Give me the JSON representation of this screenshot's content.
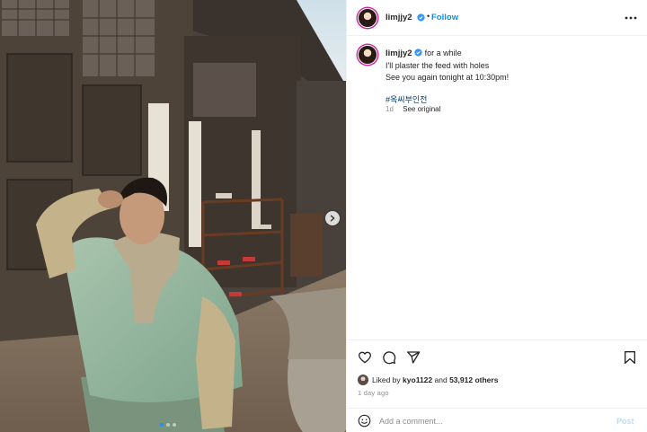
{
  "post": {
    "username": "limjjy2",
    "follow_label": "Follow",
    "separator": "•",
    "caption": {
      "username": "limjjy2",
      "lines": [
        "for a while",
        "I'll plaster the feed with holes",
        "See you again tonight at 10:30pm!"
      ],
      "hashtag": "#옥씨부인전"
    },
    "age_short": "1d",
    "see_original": "See original",
    "likes": {
      "prefix": "Liked by",
      "user": "kyo1122",
      "conjunction": "and",
      "others": "53,912 others"
    },
    "posted_ago": "1 day ago",
    "comment": {
      "placeholder": "Add a comment...",
      "post_label": "Post"
    },
    "carousel": {
      "slides": 3,
      "active": 1
    }
  },
  "colors": {
    "accent": "#0095f6",
    "hashtag": "#00376b",
    "muted": "#8e8e8e",
    "verified": "#3897f0",
    "post_disabled": "#b2dffc"
  },
  "icons": [
    "more-options-icon",
    "verified-badge-icon",
    "heart-icon",
    "comment-icon",
    "share-icon",
    "bookmark-icon",
    "emoji-icon",
    "chevron-right-icon"
  ]
}
